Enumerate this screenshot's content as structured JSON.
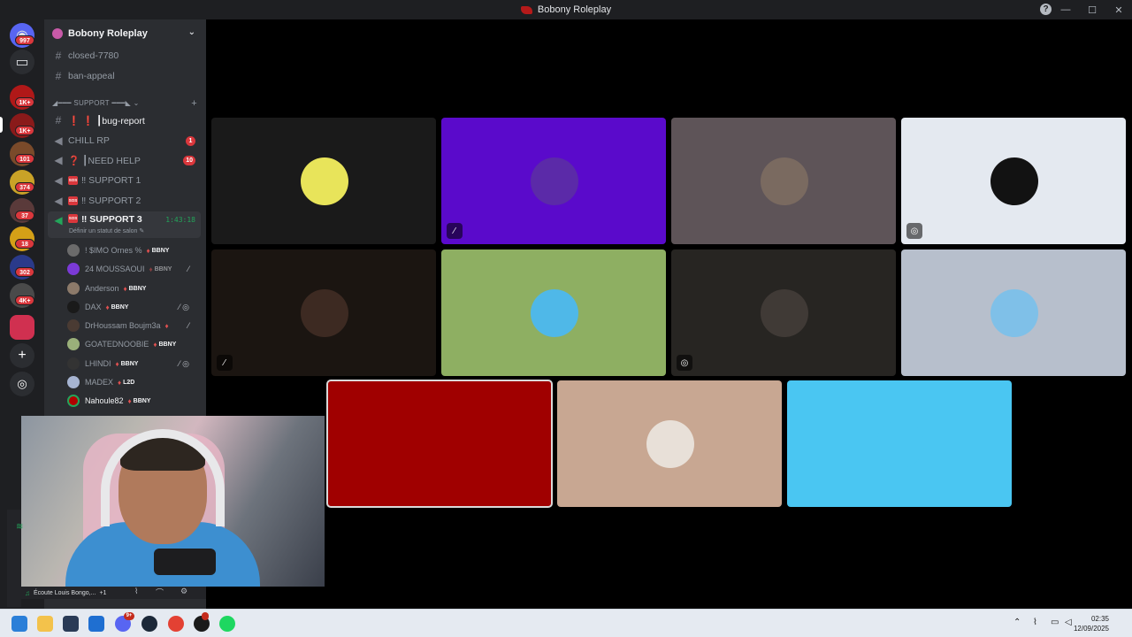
{
  "window": {
    "title": "Bobony Roleplay",
    "help_icon": "?"
  },
  "server_rail": {
    "badges": [
      "997",
      "1K+",
      "1K+",
      "101",
      "374",
      "37",
      "18",
      "302",
      "4K+"
    ],
    "add_icon": "+",
    "discover_icon": "compass"
  },
  "sidebar": {
    "server_name": "Bobony Roleplay",
    "channels_top": [
      {
        "name": "closed-7780",
        "icon": "#"
      },
      {
        "name": "ban-appeal",
        "icon": "#"
      }
    ],
    "category": "◢━━━ SUPPORT ━━━◣ ⌄",
    "channels": [
      {
        "name": "❗ ❗ ┃bug-report",
        "icon": "#"
      },
      {
        "name": "CHILL RP",
        "icon": "🔊",
        "count": "1"
      },
      {
        "name": "❓ ┃NEED HELP",
        "icon": "🔊",
        "count": "10"
      },
      {
        "name": "‼ SUPPORT 1",
        "icon": "🔊",
        "sos": "SOS"
      },
      {
        "name": "‼ SUPPORT 2",
        "icon": "🔊",
        "sos": "SOS"
      },
      {
        "name": "‼ SUPPORT 3",
        "icon": "🔊",
        "sos": "SOS",
        "timer": "1:43:18",
        "status": "Définir un statut de salon ✎"
      }
    ],
    "members": [
      {
        "name": "! $IMO Ornes %",
        "tag": "BBNY",
        "color": "#6b6b6b"
      },
      {
        "name": "24 MOUSSAOUI",
        "tag": "BBNY",
        "color": "#7b3ad6"
      },
      {
        "name": "Anderson",
        "tag": "BBNY",
        "color": "#8c7a6a"
      },
      {
        "name": "DAX",
        "tag": "BBNY",
        "color": "#1a1a1a"
      },
      {
        "name": "DrHoussam Boujm3a",
        "tag": "",
        "color": "#4a3b33"
      },
      {
        "name": "GOATEDNOOBIE",
        "tag": "BBNY",
        "color": "#9ab07a"
      },
      {
        "name": "LHINDI",
        "tag": "BBNY",
        "color": "#333333"
      },
      {
        "name": "MADEX",
        "tag": "L2D",
        "color": "#a6b4d2"
      },
      {
        "name": "Nahoule82",
        "tag": "BBNY",
        "color": "#b00000"
      }
    ],
    "status_text": "Écoute Louis Bongo,...",
    "status_extra": "+1"
  },
  "grid": {
    "tiles": [
      {
        "bg": "#1a1a1a",
        "avatar": "#e8e45a"
      },
      {
        "bg": "#5a0acb",
        "avatar": "#5b2aa8",
        "icon": "mic-off"
      },
      {
        "bg": "#5e5458",
        "avatar": "#7a6a60"
      },
      {
        "bg": "#e4e9f0",
        "avatar": "#121212",
        "icon": "deafen"
      },
      {
        "bg": "#1b1511",
        "avatar": "#3d2a22",
        "icon": "mic-off"
      },
      {
        "bg": "#8eaf62",
        "avatar": "#4fb8e8"
      },
      {
        "bg": "#272522",
        "avatar": "#403a36",
        "icon": "deafen"
      },
      {
        "bg": "#b7bfcc",
        "avatar": "#7fc0e8"
      },
      {
        "bg": "#a00000",
        "avatar": "#a00000"
      },
      {
        "bg": "#c8a792",
        "avatar": "#e8e0d8"
      },
      {
        "bg": "#4ac6f2",
        "avatar": "#4ac6f2"
      }
    ]
  },
  "taskbar": {
    "time": "02:35",
    "date": "12/09/2025",
    "discord_badge": "9+"
  }
}
